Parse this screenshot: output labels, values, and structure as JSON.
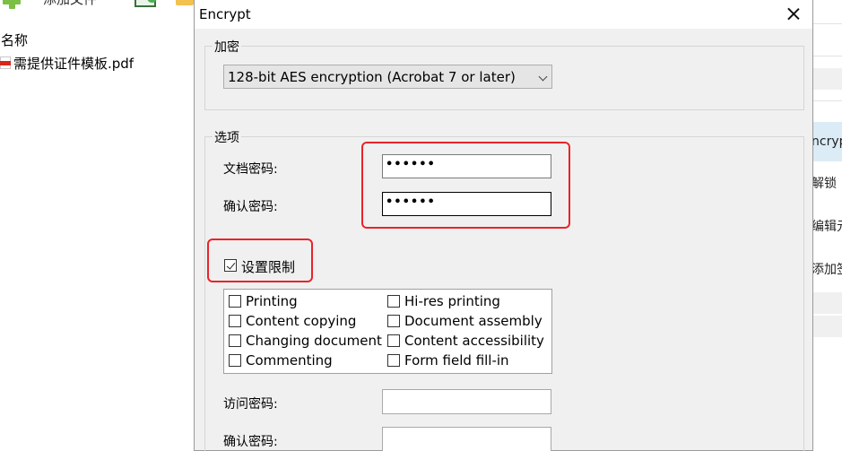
{
  "background": {
    "toolbar": {
      "add_file_label": "添加文件"
    },
    "file_list": {
      "column_header": "名称",
      "files": [
        {
          "name": "需提供证件模板.pdf"
        }
      ]
    },
    "right_panel": {
      "items": [
        "ncryp",
        "解锁",
        "编辑元",
        "添加签"
      ]
    }
  },
  "dialog": {
    "title": "Encrypt",
    "encryption_group": {
      "legend": "加密",
      "method_value": "128-bit AES encryption (Acrobat 7 or later)"
    },
    "options_group": {
      "legend": "选项",
      "doc_password_label": "文档密码:",
      "doc_password_value": "••••••",
      "confirm_password_label": "确认密码:",
      "confirm_password_value": "••••••",
      "set_restrictions_label": "设置限制",
      "set_restrictions_checked": true,
      "permissions": [
        {
          "label": "Printing",
          "checked": false
        },
        {
          "label": "Hi-res printing",
          "checked": false
        },
        {
          "label": "Content copying",
          "checked": false
        },
        {
          "label": "Document assembly",
          "checked": false
        },
        {
          "label": "Changing document",
          "checked": false
        },
        {
          "label": "Content accessibility",
          "checked": false
        },
        {
          "label": "Commenting",
          "checked": false
        },
        {
          "label": "Form field fill-in",
          "checked": false
        }
      ],
      "access_password_label": "访问密码:",
      "access_confirm_label": "确认密码:"
    }
  },
  "annotation_color": "#e8242a"
}
